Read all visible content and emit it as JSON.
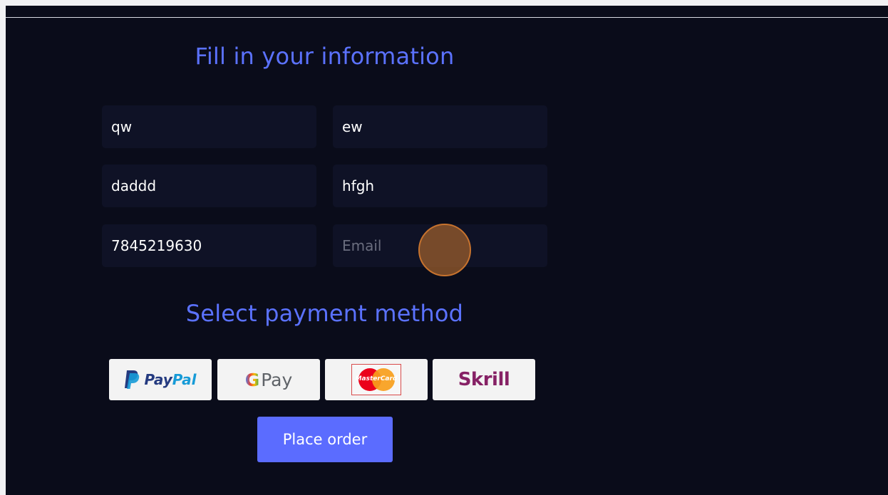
{
  "form": {
    "heading": "Fill in your information",
    "fields": [
      {
        "value": "qw",
        "placeholder": ""
      },
      {
        "value": "ew",
        "placeholder": ""
      },
      {
        "value": "daddd",
        "placeholder": ""
      },
      {
        "value": "hfgh",
        "placeholder": ""
      },
      {
        "value": "7845219630",
        "placeholder": ""
      },
      {
        "value": "",
        "placeholder": "Email"
      }
    ]
  },
  "payment": {
    "heading": "Select payment method",
    "methods": [
      {
        "name": "PayPal",
        "logo_part1": "Pay",
        "logo_part2": "Pal",
        "icon": "paypal-icon"
      },
      {
        "name": "G Pay",
        "logo_g": "G",
        "logo_rest": "Pay",
        "icon": "google-pay-icon"
      },
      {
        "name": "MasterCard",
        "logo_text": "MasterCard",
        "icon": "mastercard-icon"
      },
      {
        "name": "Skrill",
        "logo_text": "Skrill",
        "icon": "skrill-icon"
      }
    ]
  },
  "actions": {
    "place_order_label": "Place order"
  },
  "colors": {
    "background": "#0a0c1a",
    "accent": "#5b6cff",
    "heading": "#5b72ff",
    "field_bg": "#0f1226"
  }
}
